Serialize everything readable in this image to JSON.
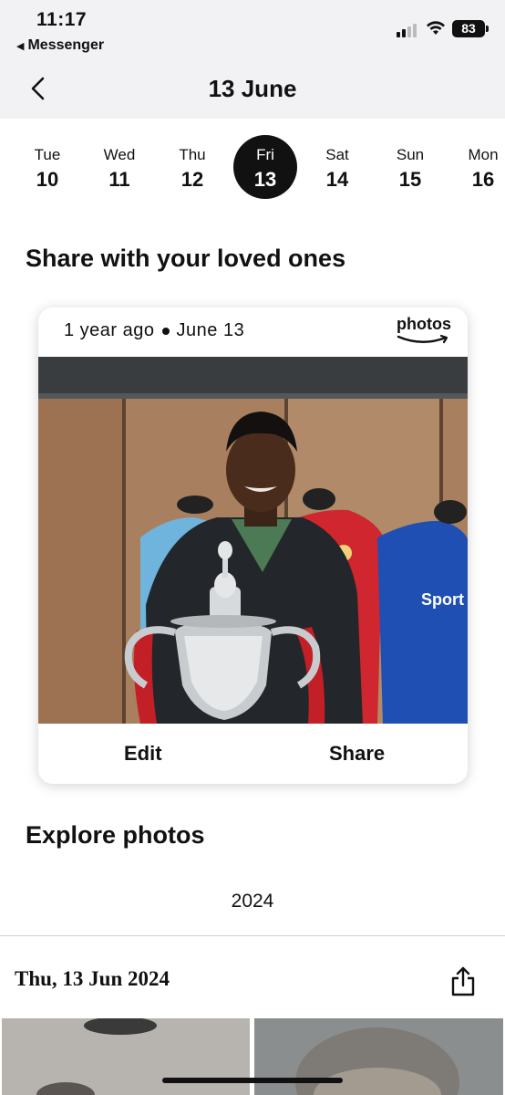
{
  "status_bar": {
    "time": "11:17",
    "back_app": "Messenger",
    "battery": "83"
  },
  "header": {
    "title": "13 June"
  },
  "days": [
    {
      "name": "Tue",
      "num": "10"
    },
    {
      "name": "Wed",
      "num": "11"
    },
    {
      "name": "Thu",
      "num": "12"
    },
    {
      "name": "Fri",
      "num": "13",
      "selected": true
    },
    {
      "name": "Sat",
      "num": "14"
    },
    {
      "name": "Sun",
      "num": "15"
    },
    {
      "name": "Mon",
      "num": "16"
    }
  ],
  "share_section": {
    "heading": "Share with your loved ones",
    "card": {
      "ago": "1 year ago",
      "date": "June 13",
      "brand": "photos",
      "edit_label": "Edit",
      "share_label": "Share"
    }
  },
  "explore": {
    "heading": "Explore photos",
    "year_tab": "2024",
    "group_title": "Thu, 13 Jun 2024"
  },
  "colors": {
    "background": "#f2f2f4",
    "selected_day": "#111111",
    "accent": "#111111"
  },
  "icons": [
    "chevron-left-icon",
    "share-icon",
    "wifi-icon",
    "cellular-signal-icon",
    "battery-icon",
    "amazon-smile-icon"
  ]
}
